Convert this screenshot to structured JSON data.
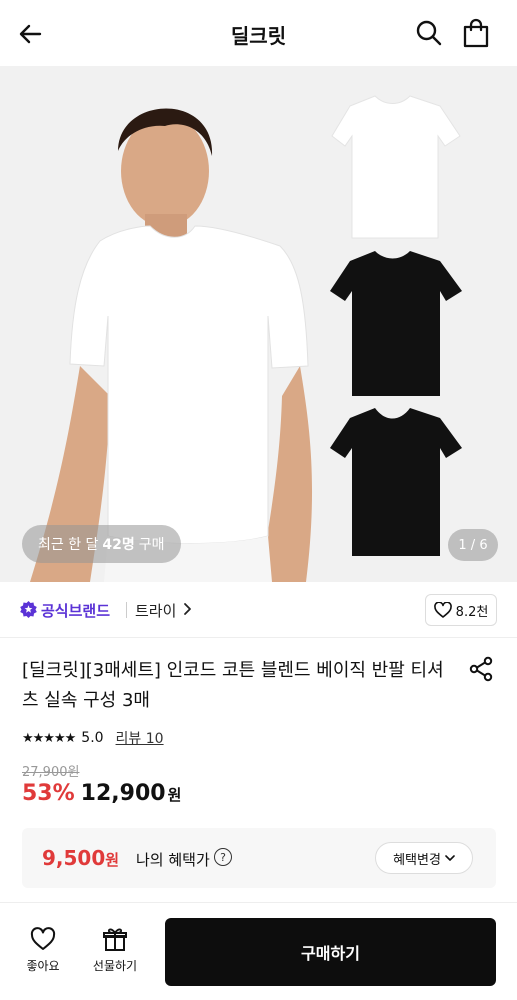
{
  "header": {
    "title": "딜크릿"
  },
  "hero": {
    "recent_prefix": "최근 한 달",
    "recent_count": "42명",
    "recent_suffix": "구매",
    "page_indicator": "1 / 6"
  },
  "brand": {
    "official_label": "공식브랜드",
    "brand_name": "트라이",
    "like_count": "8.2천"
  },
  "product": {
    "title": "[딜크릿][3매세트] 인코드 코튼 블렌드 베이직 반팔 티셔츠 실속 구성 3매",
    "rating_stars": "★★★★★",
    "rating": "5.0",
    "review_label": "리뷰 10",
    "original_price": "27,900원",
    "discount": "53%",
    "price": "12,900",
    "price_unit": "원"
  },
  "benefit": {
    "amount": "9,500",
    "amount_unit": "원",
    "my_label": "나의 혜택가",
    "info_symbol": "?",
    "change_label": "혜택변경"
  },
  "bottom": {
    "like_label": "좋아요",
    "gift_label": "선물하기",
    "buy_label": "구매하기"
  },
  "colors": {
    "accent_red": "#e03a3a",
    "brand_purple": "#5b33d6",
    "buy_button": "#0d0d0d"
  },
  "icons": [
    "back-arrow-icon",
    "search-icon",
    "shopping-bag-icon",
    "star-badge-icon",
    "chevron-right-icon",
    "heart-icon",
    "share-icon",
    "info-icon",
    "chevron-down-icon",
    "gift-icon"
  ]
}
